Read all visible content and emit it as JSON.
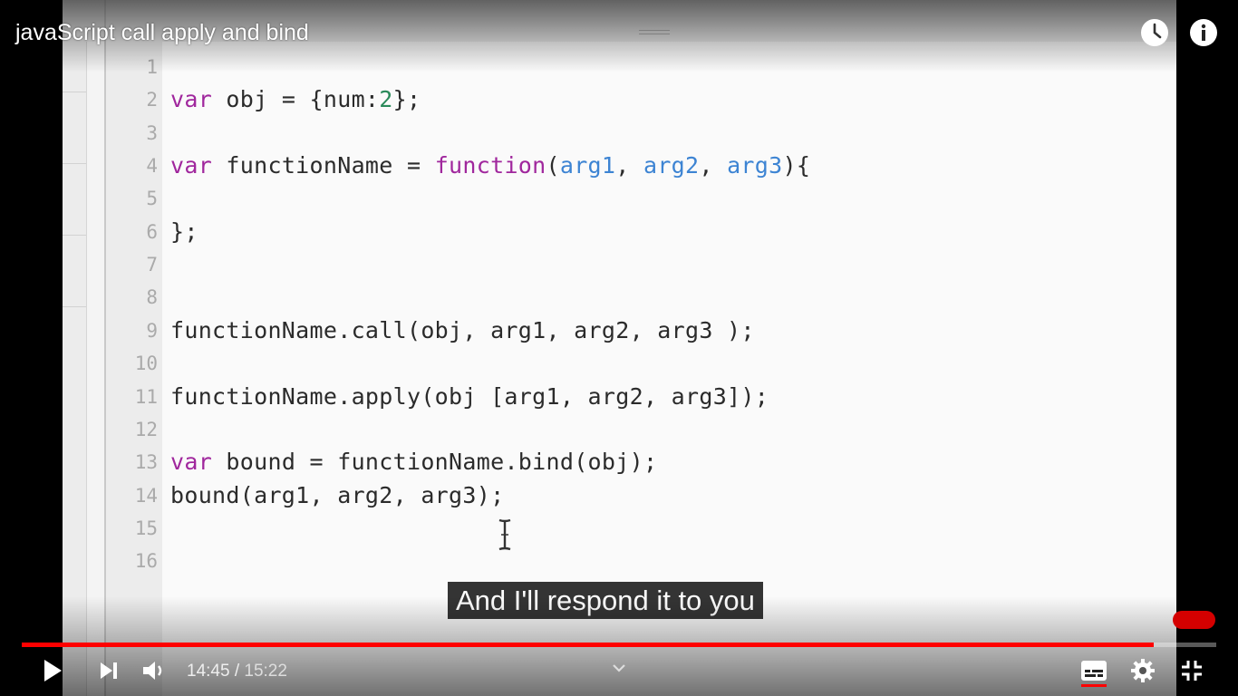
{
  "player": {
    "title": "javaScript call apply and bind",
    "caption": "And I'll respond it to you",
    "progress_fraction": 0.9475,
    "current_time": "14:45",
    "separator": "/",
    "duration": "15:22",
    "accent_color": "#ff0000",
    "icons": {
      "watch_later": "clock-icon",
      "info": "info-icon",
      "play": "play-icon",
      "next": "next-icon",
      "volume": "volume-icon",
      "chevron": "chevron-up-icon",
      "subtitles": "subtitles-icon",
      "settings": "gear-icon",
      "exit_fullscreen": "exit-fullscreen-icon"
    }
  },
  "code": {
    "line_numbers": [
      "1",
      "2",
      "3",
      "4",
      "5",
      "6",
      "7",
      "8",
      "9",
      "10",
      "11",
      "12",
      "13",
      "14",
      "15",
      "16"
    ],
    "lines": [
      [],
      [
        {
          "t": "var",
          "c": "kw"
        },
        {
          "t": " obj = {num:"
        },
        {
          "t": "2",
          "c": "nm"
        },
        {
          "t": "};"
        }
      ],
      [],
      [
        {
          "t": "var",
          "c": "kw"
        },
        {
          "t": " functionName = "
        },
        {
          "t": "function",
          "c": "kw"
        },
        {
          "t": "("
        },
        {
          "t": "arg1",
          "c": "ar"
        },
        {
          "t": ", "
        },
        {
          "t": "arg2",
          "c": "ar"
        },
        {
          "t": ", "
        },
        {
          "t": "arg3",
          "c": "ar"
        },
        {
          "t": "){"
        }
      ],
      [],
      [
        {
          "t": "};"
        }
      ],
      [],
      [],
      [
        {
          "t": "functionName.call(obj, arg1, arg2, arg3 );"
        }
      ],
      [],
      [
        {
          "t": "functionName.apply(obj [arg1, arg2, arg3]);"
        }
      ],
      [],
      [
        {
          "t": "var",
          "c": "kw"
        },
        {
          "t": " bound = functionName.bind(obj);"
        }
      ],
      [
        {
          "t": "bound(arg1, arg2, arg3);"
        }
      ],
      [],
      []
    ]
  }
}
